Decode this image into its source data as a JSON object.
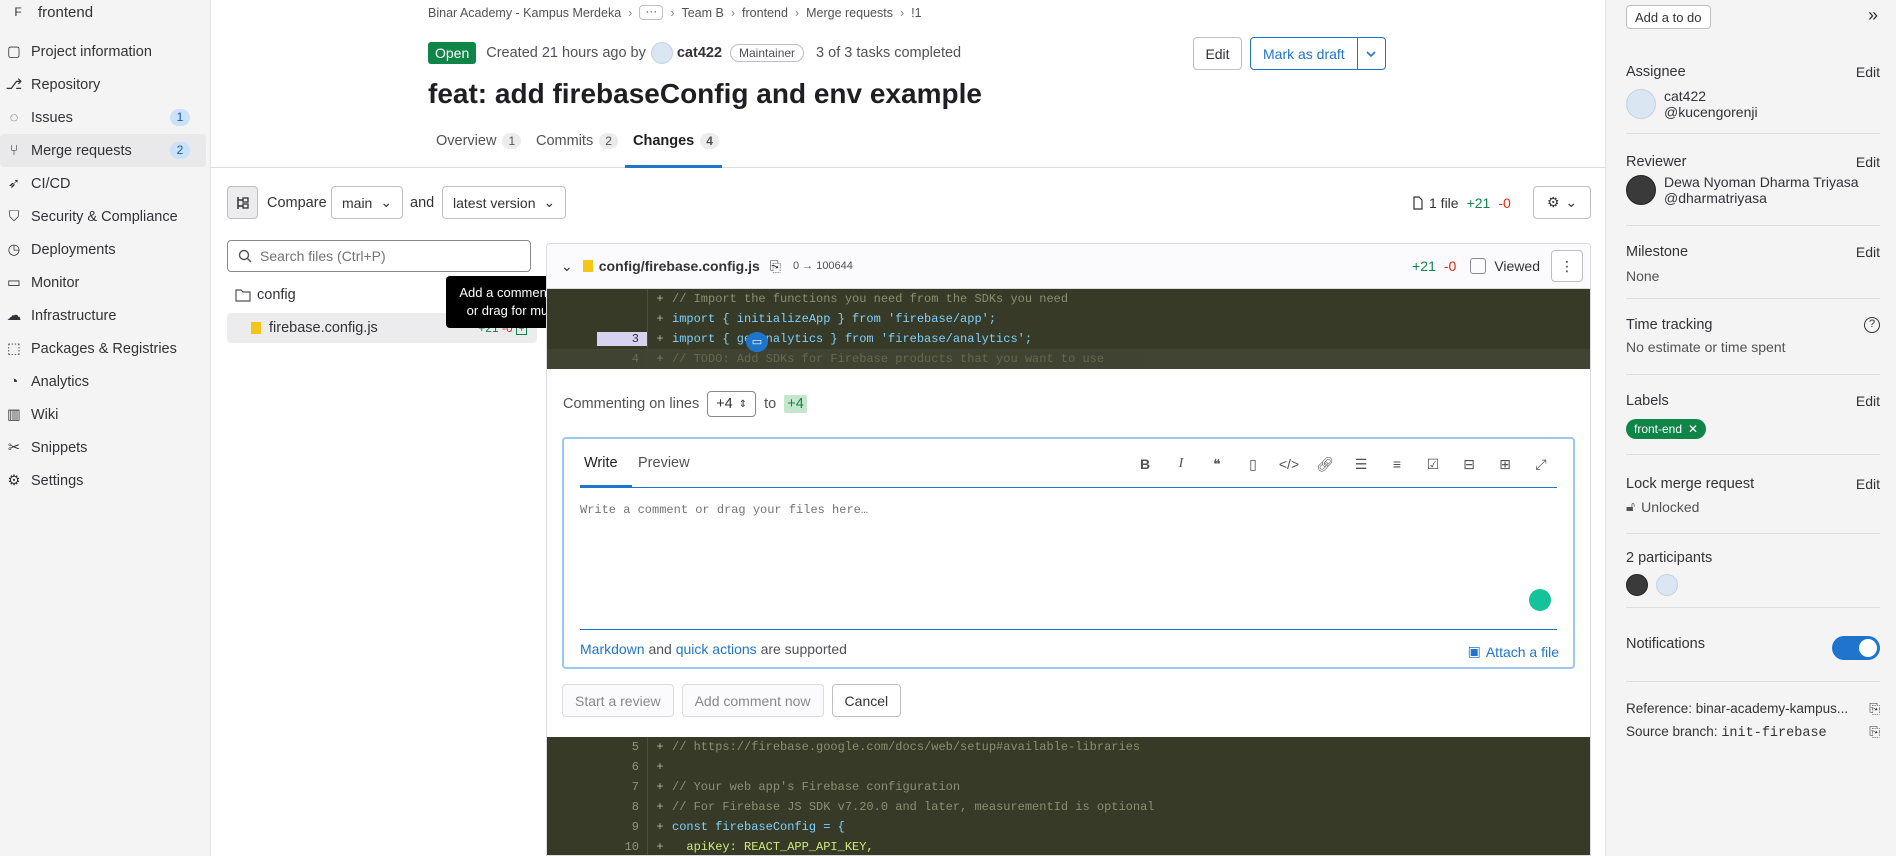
{
  "sidebar": {
    "project_initial": "F",
    "project_name": "frontend",
    "items": [
      {
        "label": "Project information",
        "icon": "project-icon"
      },
      {
        "label": "Repository",
        "icon": "repository-icon"
      },
      {
        "label": "Issues",
        "icon": "issues-icon",
        "badge": "1"
      },
      {
        "label": "Merge requests",
        "icon": "merge-request-icon",
        "badge": "2",
        "active": true
      },
      {
        "label": "CI/CD",
        "icon": "rocket-icon"
      },
      {
        "label": "Security & Compliance",
        "icon": "shield-icon"
      },
      {
        "label": "Deployments",
        "icon": "deployments-icon"
      },
      {
        "label": "Monitor",
        "icon": "monitor-icon"
      },
      {
        "label": "Infrastructure",
        "icon": "cloud-icon"
      },
      {
        "label": "Packages & Registries",
        "icon": "package-icon"
      },
      {
        "label": "Analytics",
        "icon": "chart-icon"
      },
      {
        "label": "Wiki",
        "icon": "book-icon"
      },
      {
        "label": "Snippets",
        "icon": "snippet-icon"
      },
      {
        "label": "Settings",
        "icon": "gear-icon"
      }
    ]
  },
  "breadcrumb": [
    "Binar Academy - Kampus Merdeka",
    "Team B",
    "frontend",
    "Merge requests",
    "!1"
  ],
  "mr": {
    "status": "Open",
    "created": "Created 21 hours ago by",
    "author": "cat422",
    "role": "Maintainer",
    "tasks": "3 of 3 tasks completed",
    "edit_label": "Edit",
    "draft_label": "Mark as draft",
    "title": "feat: add firebaseConfig and env example"
  },
  "tabs": [
    {
      "label": "Overview",
      "count": "1"
    },
    {
      "label": "Commits",
      "count": "2"
    },
    {
      "label": "Changes",
      "count": "4"
    }
  ],
  "compare": {
    "label": "Compare",
    "base": "main",
    "and": "and",
    "head": "latest version",
    "files": "1 file",
    "added": "+21",
    "removed": "-0"
  },
  "tree": {
    "search_placeholder": "Search files (Ctrl+P)",
    "folder": "config",
    "file": "firebase.config.js",
    "added": "+21",
    "removed": "-0",
    "tooltip": "Add a comment to this line or drag for multiple lines"
  },
  "diff": {
    "path": "config/firebase.config.js",
    "mode": "0 → 100644",
    "added": "+21",
    "removed": "-0",
    "viewed": "Viewed",
    "lines_top": [
      {
        "n": "",
        "t": "// Import the functions you need from the SDKs you need"
      },
      {
        "n": "",
        "t": "import { initializeApp } from 'firebase/app';"
      },
      {
        "n": "3",
        "t": "import { getAnalytics } from 'firebase/analytics';"
      },
      {
        "n": "4",
        "t": "// TODO: Add SDKs for Firebase products that you want to use"
      }
    ],
    "lines_bottom": [
      {
        "n": "5",
        "t": "// https://firebase.google.com/docs/web/setup#available-libraries"
      },
      {
        "n": "6",
        "t": ""
      },
      {
        "n": "7",
        "t": "// Your web app's Firebase configuration"
      },
      {
        "n": "8",
        "t": "// For Firebase JS SDK v7.20.0 and later, measurementId is optional"
      },
      {
        "n": "9",
        "t": "const firebaseConfig = {"
      },
      {
        "n": "10",
        "t": "  apiKey: REACT_APP_API_KEY,"
      }
    ]
  },
  "comment": {
    "commenting_on": "Commenting on lines",
    "from": "+4",
    "to": "to",
    "to_value": "+4",
    "write_tab": "Write",
    "preview_tab": "Preview",
    "placeholder": "Write a comment or drag your files here…",
    "markdown": "Markdown",
    "and": "and",
    "quick_actions": "quick actions",
    "supported": "are supported",
    "attach": "Attach a file",
    "start_review": "Start a review",
    "add_now": "Add comment now",
    "cancel": "Cancel"
  },
  "right": {
    "todo": "Add a to do",
    "assignee_title": "Assignee",
    "assignee_name": "cat422",
    "assignee_handle": "@kucengorenji",
    "reviewer_title": "Reviewer",
    "reviewer_name": "Dewa Nyoman Dharma Triyasa",
    "reviewer_handle": "@dharmatriyasa",
    "milestone_title": "Milestone",
    "milestone_value": "None",
    "time_title": "Time tracking",
    "time_value": "No estimate or time spent",
    "labels_title": "Labels",
    "label": "front-end",
    "lock_title": "Lock merge request",
    "lock_value": "Unlocked",
    "participants": "2 participants",
    "notifications": "Notifications",
    "reference": "Reference: binar-academy-kampus...",
    "source_branch_label": "Source branch:",
    "source_branch": "init-firebase",
    "edit": "Edit"
  }
}
